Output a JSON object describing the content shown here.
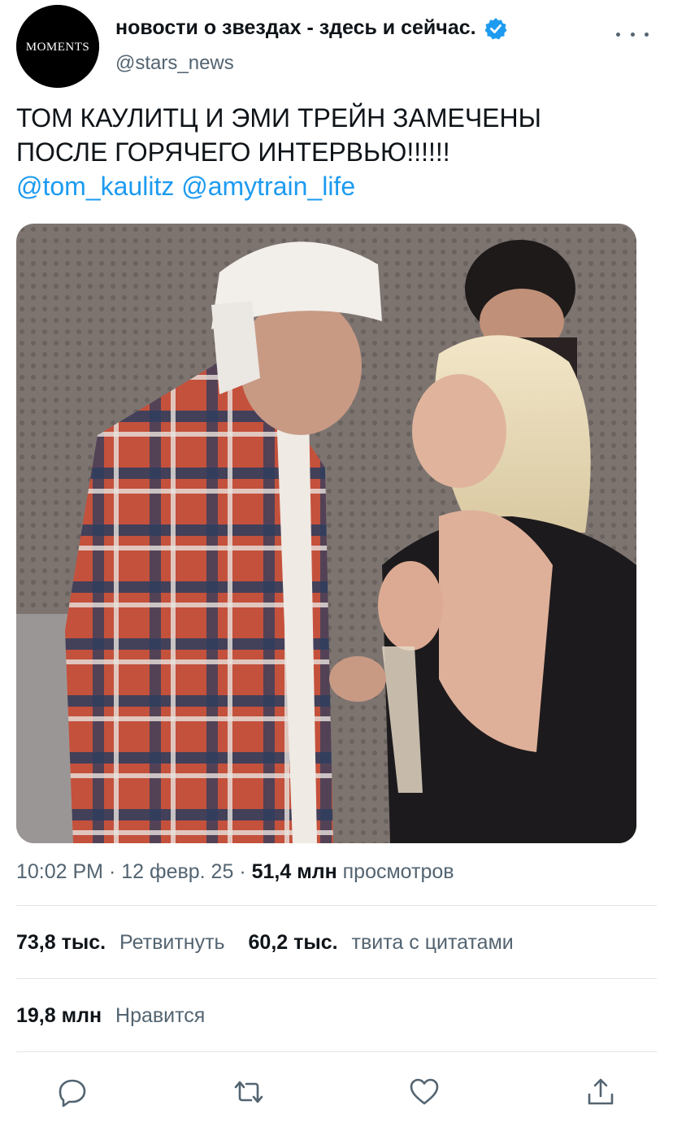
{
  "account": {
    "avatar_text": "MOMENTS",
    "display_name": "новости о звездах - здесь и сейчас.",
    "handle": "@stars_news",
    "verified": true
  },
  "tweet": {
    "text_line1": "ТОМ КАУЛИТЦ И ЭМИ ТРЕЙН ЗАМЕЧЕНЫ",
    "text_line2": "ПОСЛЕ ГОРЯЧЕГО ИНТЕРВЬЮ!!!!!!",
    "mention1": "@tom_kaulitz",
    "mention2": "@amytrain_life"
  },
  "meta": {
    "time": "10:02 PM",
    "date": "12 февр. 25",
    "views_count": "51,4 млн",
    "views_label": "просмотров"
  },
  "stats": {
    "retweets_count": "73,8 тыс.",
    "retweets_label": "Ретвитнуть",
    "quotes_count": "60,2 тыс.",
    "quotes_label": "твита с цитатами",
    "likes_count": "19,8 млн",
    "likes_label": "Нравится"
  },
  "icons": {
    "reply": "reply-icon",
    "retweet": "retweet-icon",
    "like": "heart-icon",
    "share": "share-icon",
    "verified": "verified-badge-icon",
    "more": "more-icon"
  },
  "colors": {
    "accent": "#1d9bf0",
    "text": "#0f1419",
    "secondary": "#536471"
  }
}
